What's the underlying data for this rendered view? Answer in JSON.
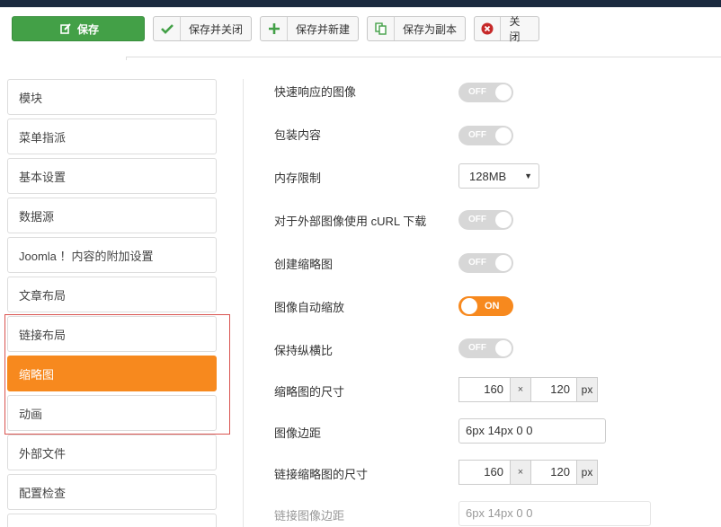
{
  "toolbar": {
    "save_label": "保存",
    "save_close_label": "保存并关闭",
    "save_new_label": "保存并新建",
    "save_copy_label": "保存为副本",
    "close_label": "关闭"
  },
  "sidebar": {
    "items": [
      {
        "label": "模块"
      },
      {
        "label": "菜单指派"
      },
      {
        "label": "基本设置"
      },
      {
        "label": "数据源"
      },
      {
        "label": "Joomla ！内容的附加设置"
      },
      {
        "label": "文章布局"
      },
      {
        "label": "链接布局"
      },
      {
        "label": "缩略图",
        "active": true
      },
      {
        "label": "动画"
      },
      {
        "label": "外部文件"
      },
      {
        "label": "配置检查"
      }
    ]
  },
  "form": {
    "responsive_images": {
      "label": "快速响应的图像",
      "value": "OFF"
    },
    "wrap_content": {
      "label": "包装内容",
      "value": "OFF"
    },
    "memory_limit": {
      "label": "内存限制",
      "value": "128MB"
    },
    "curl_external": {
      "label": "对于外部图像使用 cURL 下载",
      "value": "OFF"
    },
    "create_thumbnails": {
      "label": "创建缩略图",
      "value": "OFF"
    },
    "auto_scale": {
      "label": "图像自动缩放",
      "value": "ON"
    },
    "keep_aspect": {
      "label": "保持纵横比",
      "value": "OFF"
    },
    "thumb_size": {
      "label": "缩略图的尺寸",
      "width": "160",
      "sep": "×",
      "height": "120",
      "unit": "px"
    },
    "image_margin": {
      "label": "图像边距",
      "value": "6px 14px 0 0"
    },
    "link_thumb_size": {
      "label": "链接缩略图的尺寸",
      "width": "160",
      "sep": "×",
      "height": "120",
      "unit": "px"
    },
    "link_image_margin": {
      "label": "链接图像边距",
      "value": "6px 14px 0 0"
    }
  },
  "colors": {
    "save_green": "#43a047",
    "active_orange": "#f7891e",
    "highlight_red": "#d9534f",
    "topbar_navy": "#1b2a3f"
  }
}
